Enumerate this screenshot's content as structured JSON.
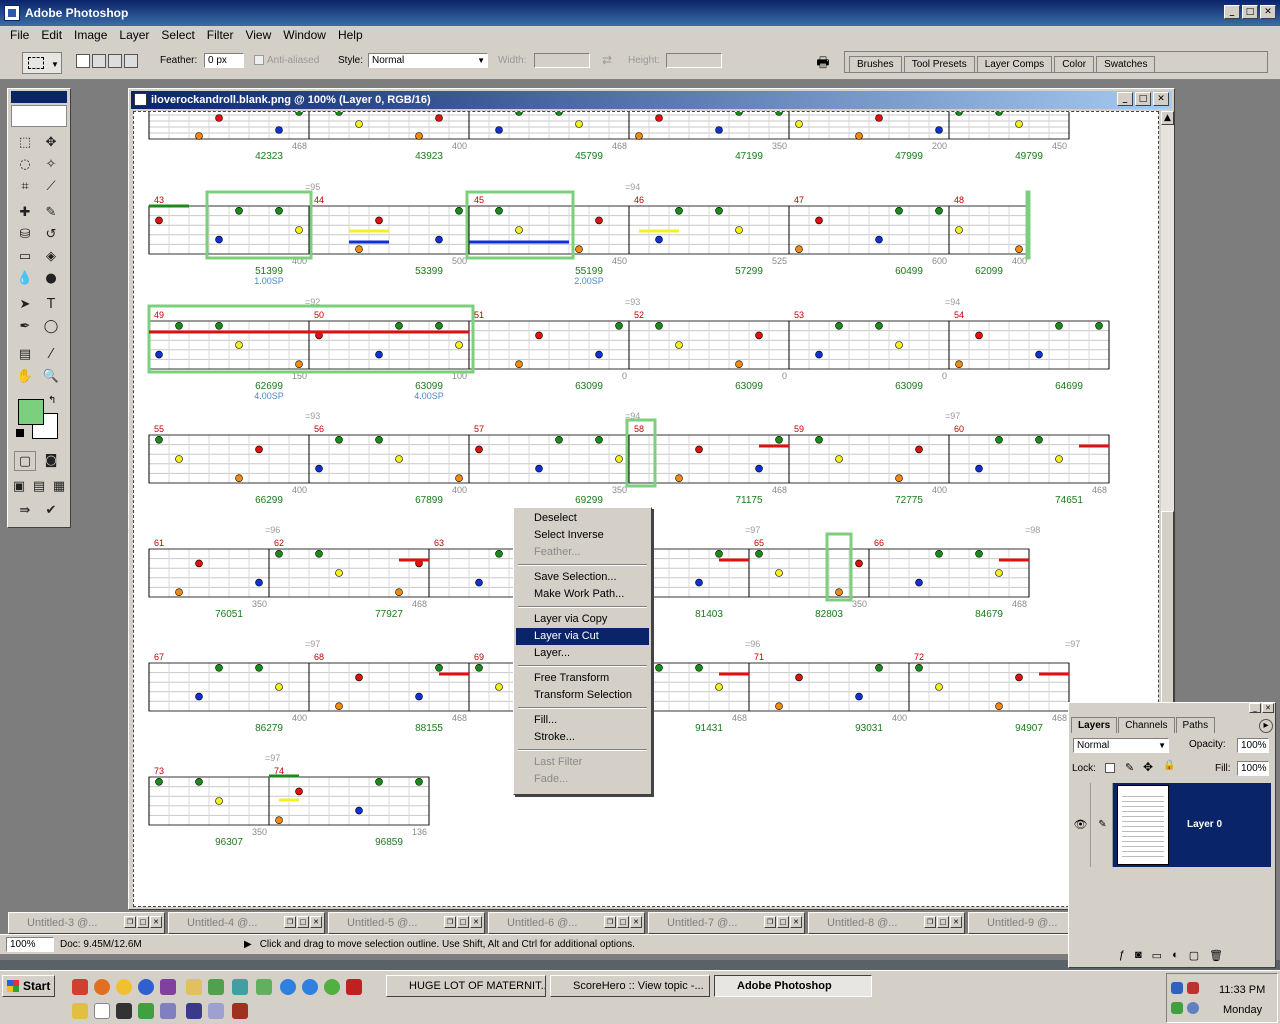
{
  "app": {
    "title": "Adobe Photoshop"
  },
  "menu": [
    "File",
    "Edit",
    "Image",
    "Layer",
    "Select",
    "Filter",
    "View",
    "Window",
    "Help"
  ],
  "options": {
    "feather_label": "Feather:",
    "feather_value": "0 px",
    "antialias_label": "Anti-aliased",
    "style_label": "Style:",
    "style_value": "Normal",
    "width_label": "Width:",
    "height_label": "Height:"
  },
  "palette_well": [
    "Brushes",
    "Tool Presets",
    "Layer Comps",
    "Color",
    "Swatches"
  ],
  "document": {
    "title": "iloverockandroll.blank.png @ 100% (Layer 0, RGB/16)"
  },
  "sheet": {
    "rows": [
      {
        "top": true,
        "measures": [],
        "labels": [
          [
            "468",
            "42323"
          ],
          [
            "400",
            "43923"
          ],
          [
            "468",
            "45799"
          ],
          [
            "350",
            "47199"
          ],
          [
            "200",
            "47999"
          ],
          [
            "450",
            "49799"
          ]
        ]
      },
      {
        "tempos": [
          "=95",
          "=94"
        ],
        "measures": [
          "43",
          "44",
          "45",
          "46",
          "47",
          "48"
        ],
        "labels": [
          [
            "400",
            "51399",
            "1.00SP"
          ],
          [
            "500",
            "53399",
            ""
          ],
          [
            "450",
            "55199",
            "2.00SP"
          ],
          [
            "525",
            "57299",
            ""
          ],
          [
            "600",
            "60499",
            ""
          ],
          [
            "400",
            "62099",
            ""
          ]
        ]
      },
      {
        "tempos": [
          "=92",
          "=93",
          "=94"
        ],
        "measures": [
          "49",
          "50",
          "51",
          "52",
          "53",
          "54"
        ],
        "labels": [
          [
            "150",
            "62699",
            "4.00SP"
          ],
          [
            "100",
            "63099",
            "4.00SP"
          ],
          [
            "0",
            "63099",
            ""
          ],
          [
            "0",
            "63099",
            ""
          ],
          [
            "0",
            "63099",
            ""
          ],
          [
            "",
            "64699",
            ""
          ]
        ]
      },
      {
        "tempos": [
          "=93",
          "=94",
          "=97"
        ],
        "measures": [
          "55",
          "56",
          "57",
          "58",
          "59",
          "60"
        ],
        "labels": [
          [
            "400",
            "66299"
          ],
          [
            "400",
            "67899"
          ],
          [
            "350",
            "69299"
          ],
          [
            "468",
            "71175"
          ],
          [
            "400",
            "72775"
          ],
          [
            "468",
            "74651"
          ]
        ]
      },
      {
        "tempos": [
          "=96",
          "=97",
          "=98"
        ],
        "measures": [
          "61",
          "62",
          "63",
          "65",
          "66"
        ],
        "labels": [
          [
            "350",
            "76051"
          ],
          [
            "468",
            "77927"
          ],
          [
            "",
            "81403"
          ],
          [
            "350",
            "82803"
          ],
          [
            "468",
            "84679"
          ]
        ]
      },
      {
        "tempos": [
          "=97",
          "=96",
          "=97"
        ],
        "measures": [
          "67",
          "68",
          "69",
          "71",
          "72"
        ],
        "labels": [
          [
            "400",
            "86279"
          ],
          [
            "468",
            "88155"
          ],
          [
            "468",
            "91431"
          ],
          [
            "400",
            "93031"
          ],
          [
            "468",
            "94907"
          ]
        ]
      },
      {
        "tempos": [
          "=97"
        ],
        "measures": [
          "73",
          "74"
        ],
        "labels": [
          [
            "350",
            "96307"
          ],
          [
            "136",
            "96859"
          ]
        ]
      }
    ]
  },
  "context_menu": {
    "items": [
      {
        "label": "Deselect",
        "state": "enabled"
      },
      {
        "label": "Select Inverse",
        "state": "enabled"
      },
      {
        "label": "Feather...",
        "state": "disabled"
      },
      {
        "sep": true
      },
      {
        "label": "Save Selection...",
        "state": "enabled"
      },
      {
        "label": "Make Work Path...",
        "state": "enabled"
      },
      {
        "sep": true
      },
      {
        "label": "Layer via Copy",
        "state": "enabled"
      },
      {
        "label": "Layer via Cut",
        "state": "highlighted"
      },
      {
        "label": "Layer...",
        "state": "enabled"
      },
      {
        "sep": true
      },
      {
        "label": "Free Transform",
        "state": "enabled"
      },
      {
        "label": "Transform Selection",
        "state": "enabled"
      },
      {
        "sep": true
      },
      {
        "label": "Fill...",
        "state": "enabled"
      },
      {
        "label": "Stroke...",
        "state": "enabled"
      },
      {
        "sep": true
      },
      {
        "label": "Last Filter",
        "state": "disabled"
      },
      {
        "label": "Fade...",
        "state": "disabled"
      }
    ]
  },
  "minimized_docs": [
    "Untitled-3 @...",
    "Untitled-4 @...",
    "Untitled-5 @...",
    "Untitled-6 @...",
    "Untitled-7 @...",
    "Untitled-8 @...",
    "Untitled-9 @..."
  ],
  "status": {
    "zoom": "100%",
    "doc": "Doc: 9.45M/12.6M",
    "hint": "Click and drag to move selection outline.  Use Shift, Alt and Ctrl for additional options."
  },
  "layers": {
    "tabs": [
      "Layers",
      "Channels",
      "Paths"
    ],
    "blend": "Normal",
    "opacity_label": "Opacity:",
    "opacity": "100%",
    "lock_label": "Lock:",
    "fill_label": "Fill:",
    "fill": "100%",
    "layer_name": "Layer 0"
  },
  "taskbar": {
    "start": "Start",
    "buttons": [
      "HUGE LOT OF MATERNIT...",
      "ScoreHero :: View topic -...",
      "Adobe Photoshop"
    ],
    "time": "11:33 PM",
    "day": "Monday"
  },
  "colors": {
    "foreground": "#7ccf7c",
    "background": "#ffffff",
    "note_green": "#1a8a1a",
    "note_red": "#e01010",
    "note_yellow": "#f5f020",
    "note_blue": "#1030d0",
    "note_orange": "#f08a10",
    "measure_red": "#c00000",
    "score_green": "#1a7a1a",
    "sp_blue": "#4a8ac8"
  }
}
